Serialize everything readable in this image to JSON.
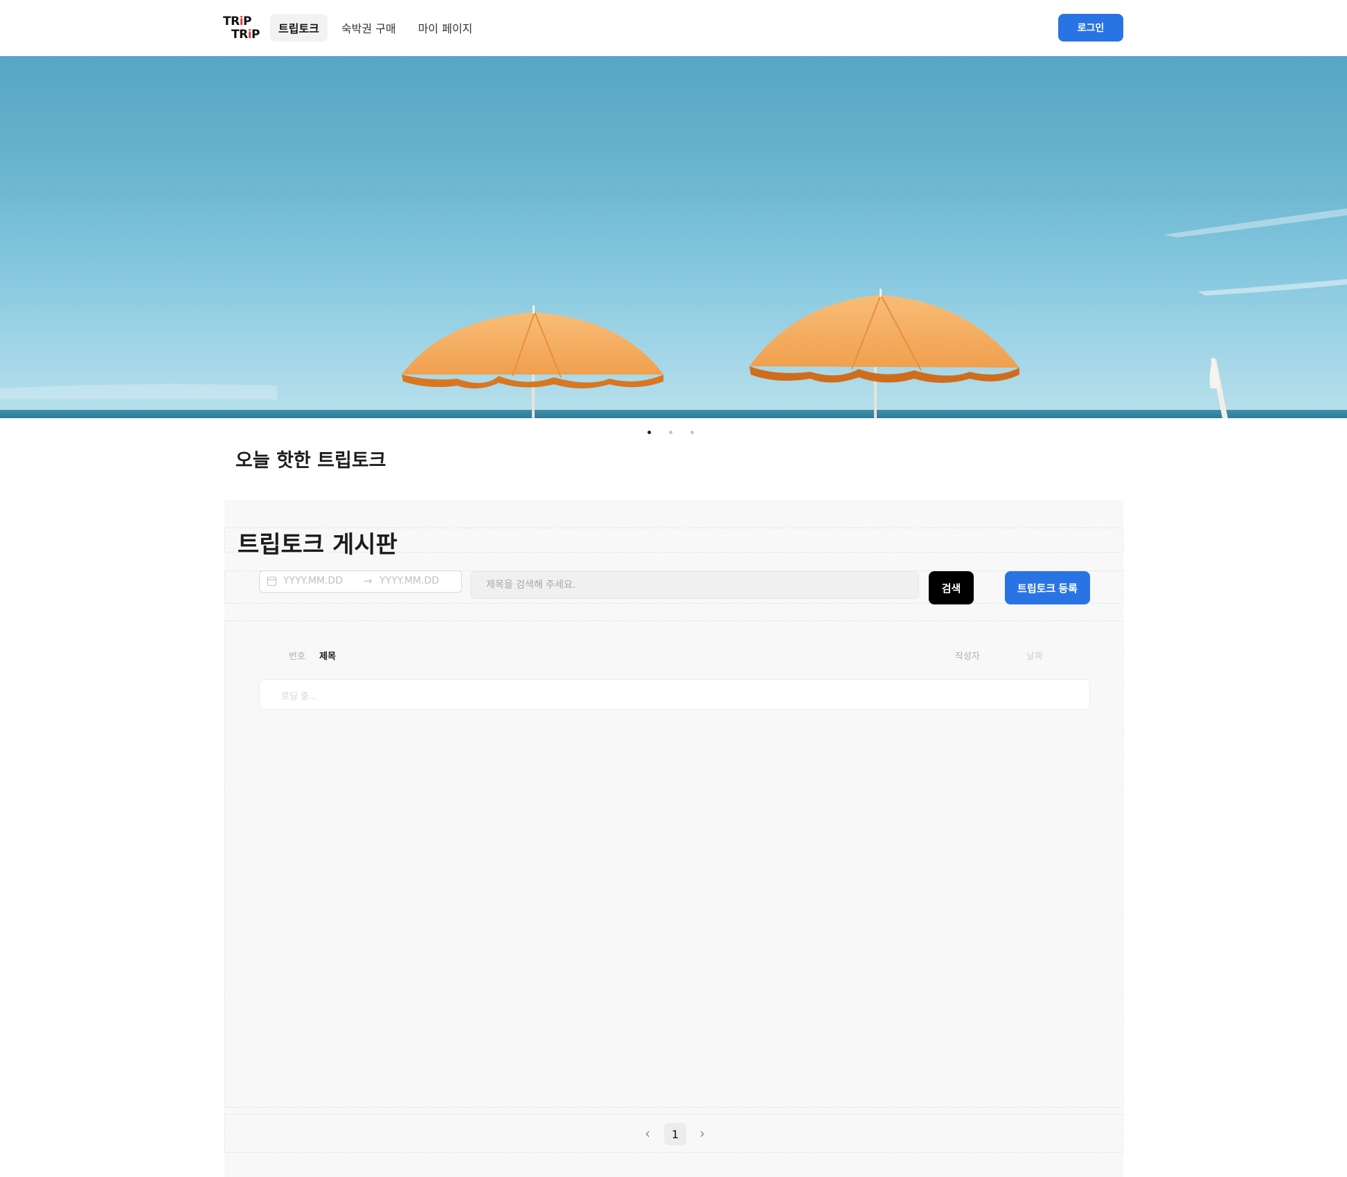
{
  "header": {
    "logo_line1": "TRiP",
    "logo_line2": "TRiP",
    "nav": [
      {
        "label": "트립토크",
        "active": true
      },
      {
        "label": "숙박권 구매",
        "active": false
      },
      {
        "label": "마이 페이지",
        "active": false
      }
    ],
    "login_label": "로그인"
  },
  "banner": {
    "slide_count": 3,
    "active_slide": 1,
    "image": "beach-umbrellas-sky"
  },
  "hot_section": {
    "title": "오늘 핫한 트립토크"
  },
  "board": {
    "title": "트립토크 게시판",
    "search": {
      "date_start_placeholder": "YYYY.MM.DD",
      "date_end_placeholder": "YYYY.MM.DD",
      "input_placeholder": "제목을 검색해 주세요.",
      "search_label": "검색",
      "register_label": "트립토크 등록"
    },
    "columns": {
      "number": "번호",
      "title": "제목",
      "writer": "작성자",
      "date": "날짜"
    },
    "loading_text": "로딩 중...",
    "pagination": {
      "prev_icon": "chevron-left-icon",
      "current_page": "1",
      "next_icon": "chevron-right-icon"
    }
  },
  "colors": {
    "primary": "#2974e5",
    "search_button": "#000000",
    "board_background": "#f8f8f8"
  }
}
